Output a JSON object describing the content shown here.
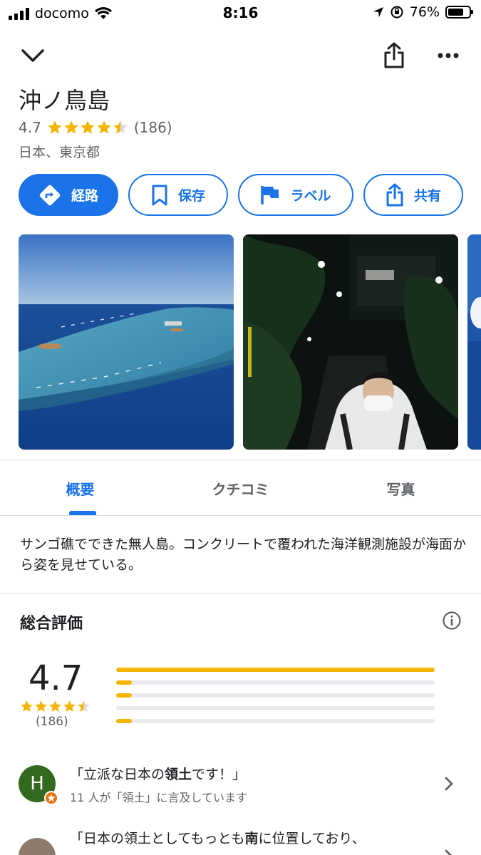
{
  "status_bar": {
    "carrier": "docomo",
    "time": "8:16",
    "battery_percent": "76%",
    "battery_level": 0.76
  },
  "nav": {
    "collapse_icon": "chevron-down-icon",
    "share_icon": "share-icon",
    "more_icon": "more-horizontal-icon"
  },
  "place": {
    "name": "沖ノ鳥島",
    "rating": "4.7",
    "rating_value": 4.7,
    "review_count": "(186)",
    "location": "日本、東京都"
  },
  "actions": [
    {
      "label": "経路",
      "icon": "directions-icon"
    },
    {
      "label": "保存",
      "icon": "bookmark-icon"
    },
    {
      "label": "ラベル",
      "icon": "flag-icon"
    },
    {
      "label": "共有",
      "icon": "share-icon"
    }
  ],
  "photos": [
    {
      "name": "aerial-reef-photo"
    },
    {
      "name": "night-street-photo"
    },
    {
      "name": "sky-photo-partial"
    }
  ],
  "tabs": [
    {
      "label": "概要",
      "active": true
    },
    {
      "label": "クチコミ",
      "active": false
    },
    {
      "label": "写真",
      "active": false
    }
  ],
  "description": "サンゴ礁でできた無人島。コンクリートで覆われた海洋観測施設が海面から姿を見せている。",
  "summary": {
    "title": "総合評価",
    "rating": "4.7",
    "count": "(186)",
    "distribution": [
      {
        "stars": 5,
        "fraction": 1.0
      },
      {
        "stars": 4,
        "fraction": 0.05
      },
      {
        "stars": 3,
        "fraction": 0.05
      },
      {
        "stars": 2,
        "fraction": 0.0
      },
      {
        "stars": 1,
        "fraction": 0.05
      }
    ]
  },
  "topics": [
    {
      "avatar_letter": "H",
      "avatar_color": "#33691e",
      "quote_parts": [
        "「立派な日本の",
        "領土",
        "です！」"
      ],
      "sub": "11 人が「領土」に言及しています"
    },
    {
      "avatar_letter": "",
      "avatar_color": "#8d7b6b",
      "quote_parts": [
        "「日本の領土としてもっとも",
        "南",
        "に位置しており、"
      ],
      "sub": ""
    }
  ],
  "colors": {
    "accent": "#1a73e8",
    "star": "#f4b400",
    "star_empty": "#dadce0"
  }
}
